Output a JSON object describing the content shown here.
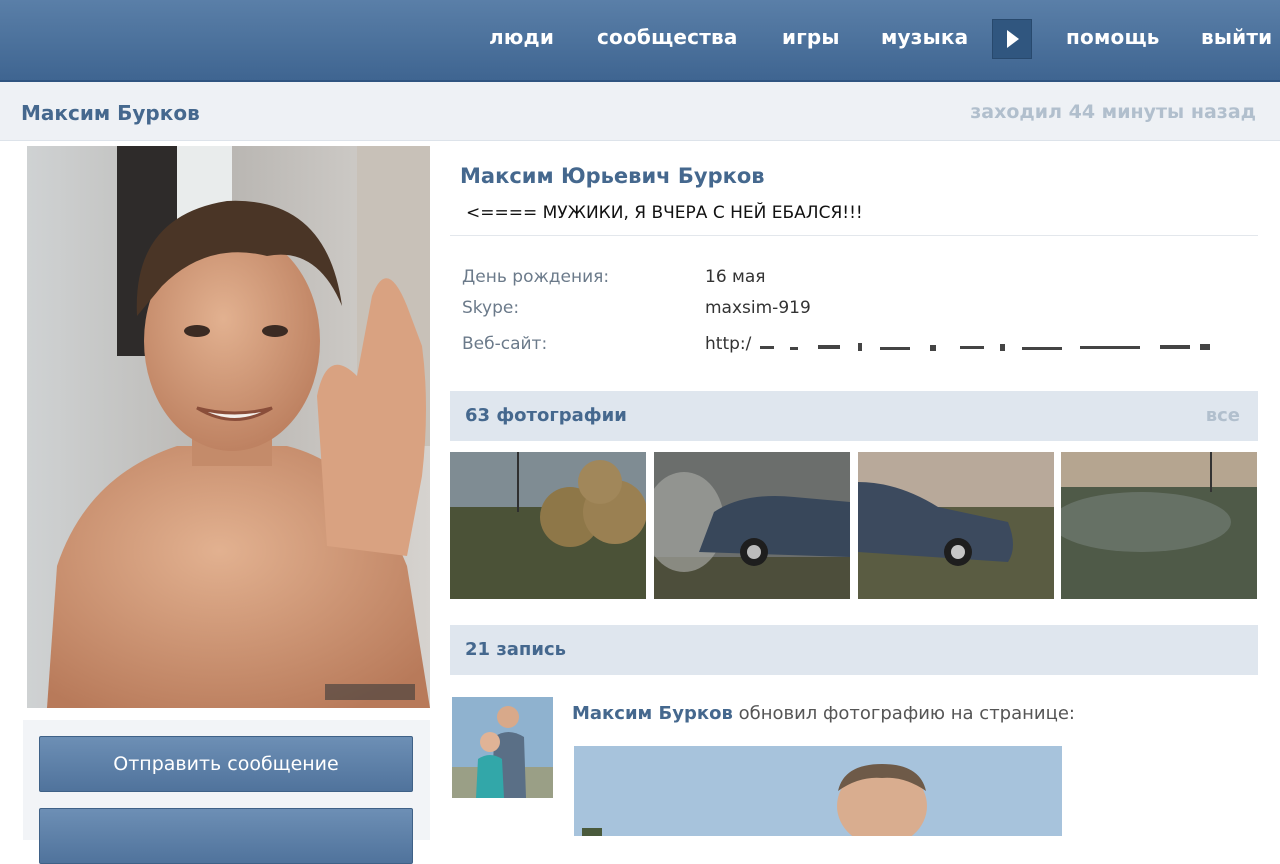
{
  "nav": {
    "items": [
      "люди",
      "сообщества",
      "игры",
      "музыка"
    ],
    "help": "помощь",
    "logout": "выйти"
  },
  "header": {
    "user_name": "Максим Бурков",
    "last_seen": "заходил 44 минуты назад"
  },
  "profile": {
    "full_name": "Максим Юрьевич Бурков",
    "status": "<==== МУЖИКИ, Я ВЧЕРА С НЕЙ ЕБАЛСЯ!!!",
    "info": [
      {
        "label": "День рождения:",
        "value": "16 мая"
      },
      {
        "label": "Skype:",
        "value": "maxsim-919"
      },
      {
        "label": "Веб-сайт:",
        "value": "http:/"
      }
    ]
  },
  "photos": {
    "title": "63 фотографии",
    "all_label": "все"
  },
  "wall": {
    "title": "21 запись",
    "post_author": "Максим Бурков",
    "post_action": " обновил фотографию на странице:"
  },
  "actions": {
    "send_message": "Отправить сообщение"
  },
  "colors": {
    "accent": "#45688e",
    "topbar": "#4a6f99",
    "section_bg": "#dfe6ee"
  },
  "icons": {
    "player": "play-icon"
  }
}
